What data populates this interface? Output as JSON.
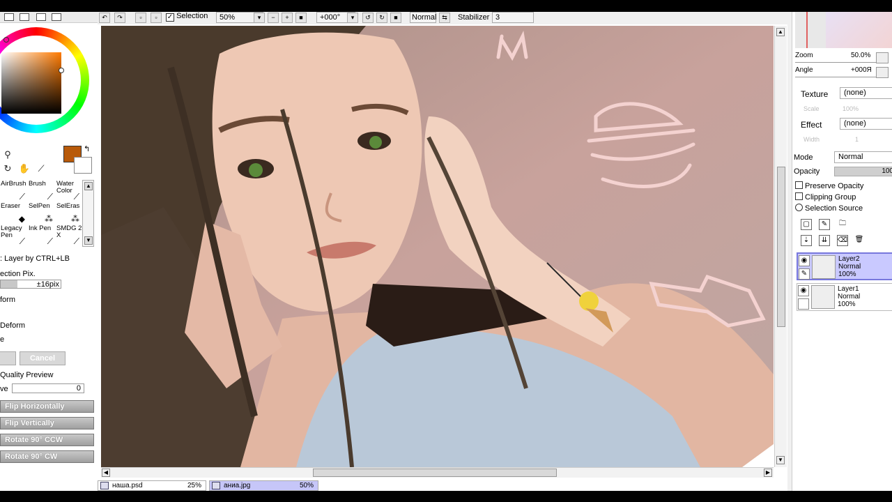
{
  "toolbar": {
    "selection_label": "Selection",
    "zoom_value": "50%",
    "angle_value": "+000°",
    "blend_mode": "Normal",
    "stabilizer_label": "Stabilizer",
    "stabilizer_value": "3"
  },
  "left_panel": {
    "brushes": [
      {
        "label": "AirBrush",
        "icon": "airbrush-icon"
      },
      {
        "label": "Brush",
        "icon": "brush-icon"
      },
      {
        "label": "Water Color",
        "icon": "watercolor-icon"
      },
      {
        "label": "Eraser",
        "icon": "eraser-icon"
      },
      {
        "label": "SelPen",
        "icon": "selpen-icon"
      },
      {
        "label": "SelEras",
        "icon": "seleras-icon"
      },
      {
        "label": "Legacy Pen",
        "icon": "legacy-pen-icon"
      },
      {
        "label": "Ink Pen",
        "icon": "ink-pen-icon"
      },
      {
        "label": "SMDG 2 X",
        "icon": "smdg-icon"
      }
    ],
    "layer_by_ctrl": ": Layer by CTRL+LB",
    "selection_pix": "ection Pix.",
    "pix_value": "±16pix",
    "transform": "form",
    "deform": "Deform",
    "e_label": "e",
    "cancel": "Cancel",
    "quality_preview": "Quality Preview",
    "ve_label": "ve",
    "ve_value": "0",
    "flip_h": "Flip Horizontally",
    "flip_v": "Flip Vertically",
    "rot_ccw": "Rotate 90° CCW",
    "rot_cw": "Rotate 90° CW",
    "fg_color": "#b85a0a"
  },
  "right_panel": {
    "zoom_label": "Zoom",
    "zoom_value": "50.0%",
    "angle_label": "Angle",
    "angle_value": "+000Я",
    "texture_label": "Texture",
    "texture_value": "(none)",
    "scale_label": "Scale",
    "scale_value": "100%",
    "effect_label": "Effect",
    "effect_value": "(none)",
    "width_label": "Width",
    "width_value": "1",
    "mode_label": "Mode",
    "mode_value": "Normal",
    "opacity_label": "Opacity",
    "opacity_value": "100",
    "preserve_opacity": "Preserve Opacity",
    "clipping_group": "Clipping Group",
    "selection_source": "Selection Source",
    "layers": [
      {
        "name": "Layer2",
        "mode": "Normal",
        "opacity": "100%"
      },
      {
        "name": "Layer1",
        "mode": "Normal",
        "opacity": "100%"
      }
    ]
  },
  "doc_tabs": [
    {
      "name": "наша.psd",
      "zoom": "25%"
    },
    {
      "name": "аниа.jpg",
      "zoom": "50%"
    }
  ]
}
